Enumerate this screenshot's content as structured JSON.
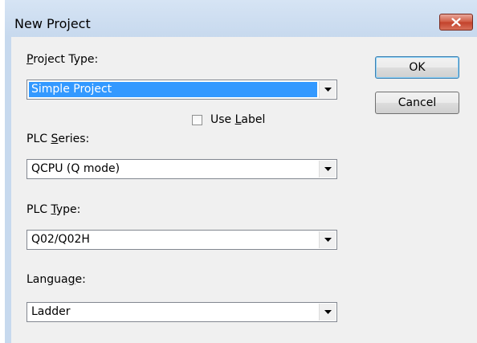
{
  "window": {
    "title": "New Project",
    "close_icon": "close-icon"
  },
  "project_type": {
    "label_prefix": "",
    "label_accel": "P",
    "label_rest": "roject Type:",
    "value": "Simple Project"
  },
  "use_label": {
    "label_prefix": "Use ",
    "label_accel": "L",
    "label_rest": "abel",
    "checked": false
  },
  "plc_series": {
    "label_prefix": "PLC ",
    "label_accel": "S",
    "label_rest": "eries:",
    "value": "QCPU (Q mode)"
  },
  "plc_type": {
    "label_prefix": "PLC ",
    "label_accel": "T",
    "label_rest": "ype:",
    "value": "Q02/Q02H"
  },
  "language": {
    "label_prefix": "Langua",
    "label_accel": "g",
    "label_rest": "e:",
    "value": "Ladder"
  },
  "buttons": {
    "ok": "OK",
    "cancel": "Cancel"
  },
  "colors": {
    "selection": "#3399ff",
    "close_button": "#c2412a",
    "titlebar": "#c7d9ee"
  }
}
